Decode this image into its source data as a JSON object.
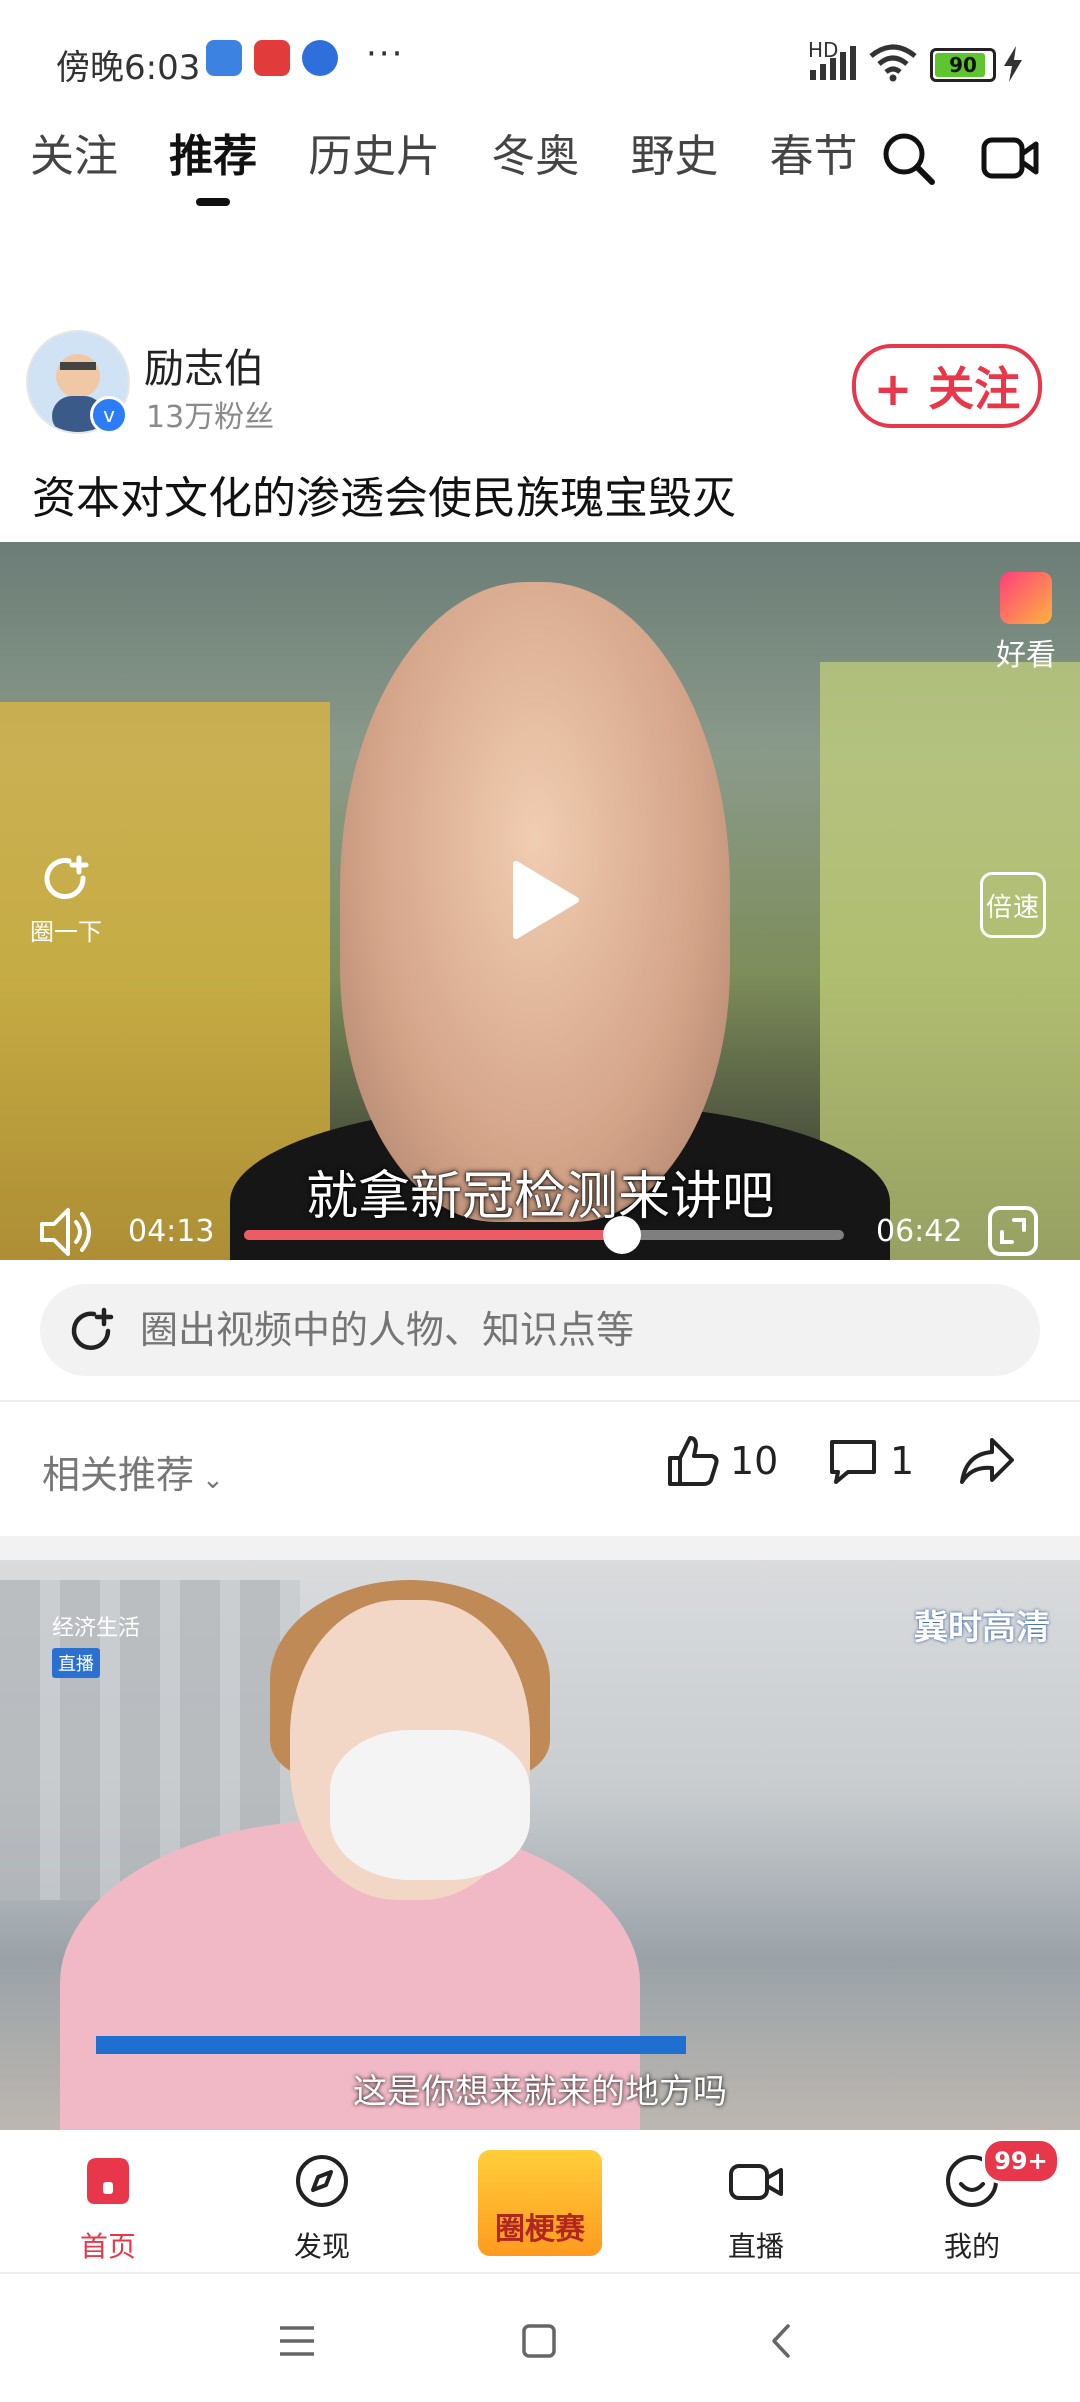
{
  "status_bar": {
    "time": "傍晚6:03",
    "more": "···",
    "network": "HD",
    "battery": "90"
  },
  "tabs": [
    "关注",
    "推荐",
    "历史片",
    "冬奥",
    "野史",
    "春节"
  ],
  "active_tab_index": 1,
  "post": {
    "author_name": "励志伯",
    "author_fans": "13万粉丝",
    "follow_label": "+ 关注",
    "title": "资本对文化的渗透会使民族瑰宝毁灭"
  },
  "video": {
    "brand_label": "好看",
    "circle_label": "圈一下",
    "speed_label": "倍速",
    "subtitle": "就拿新冠检测来讲吧",
    "current_time": "04:13",
    "total_time": "06:42",
    "progress": 0.63
  },
  "circle_search": {
    "placeholder": "圈出视频中的人物、知识点等"
  },
  "actions": {
    "related_label": "相关推荐",
    "like_count": "10",
    "comment_count": "1"
  },
  "video2": {
    "channel_left": "经济生活",
    "channel_left_live": "直播",
    "channel_right": "冀时高清",
    "caption": "这是你想来就来的地方吗"
  },
  "bottom_nav": {
    "items": [
      "首页",
      "发现",
      "直播",
      "我的"
    ],
    "center_label": "圈梗赛",
    "badge": "99+"
  },
  "colors": {
    "accent": "#e8374a",
    "progress": "#ef5b64",
    "battery": "#5fc52e"
  }
}
